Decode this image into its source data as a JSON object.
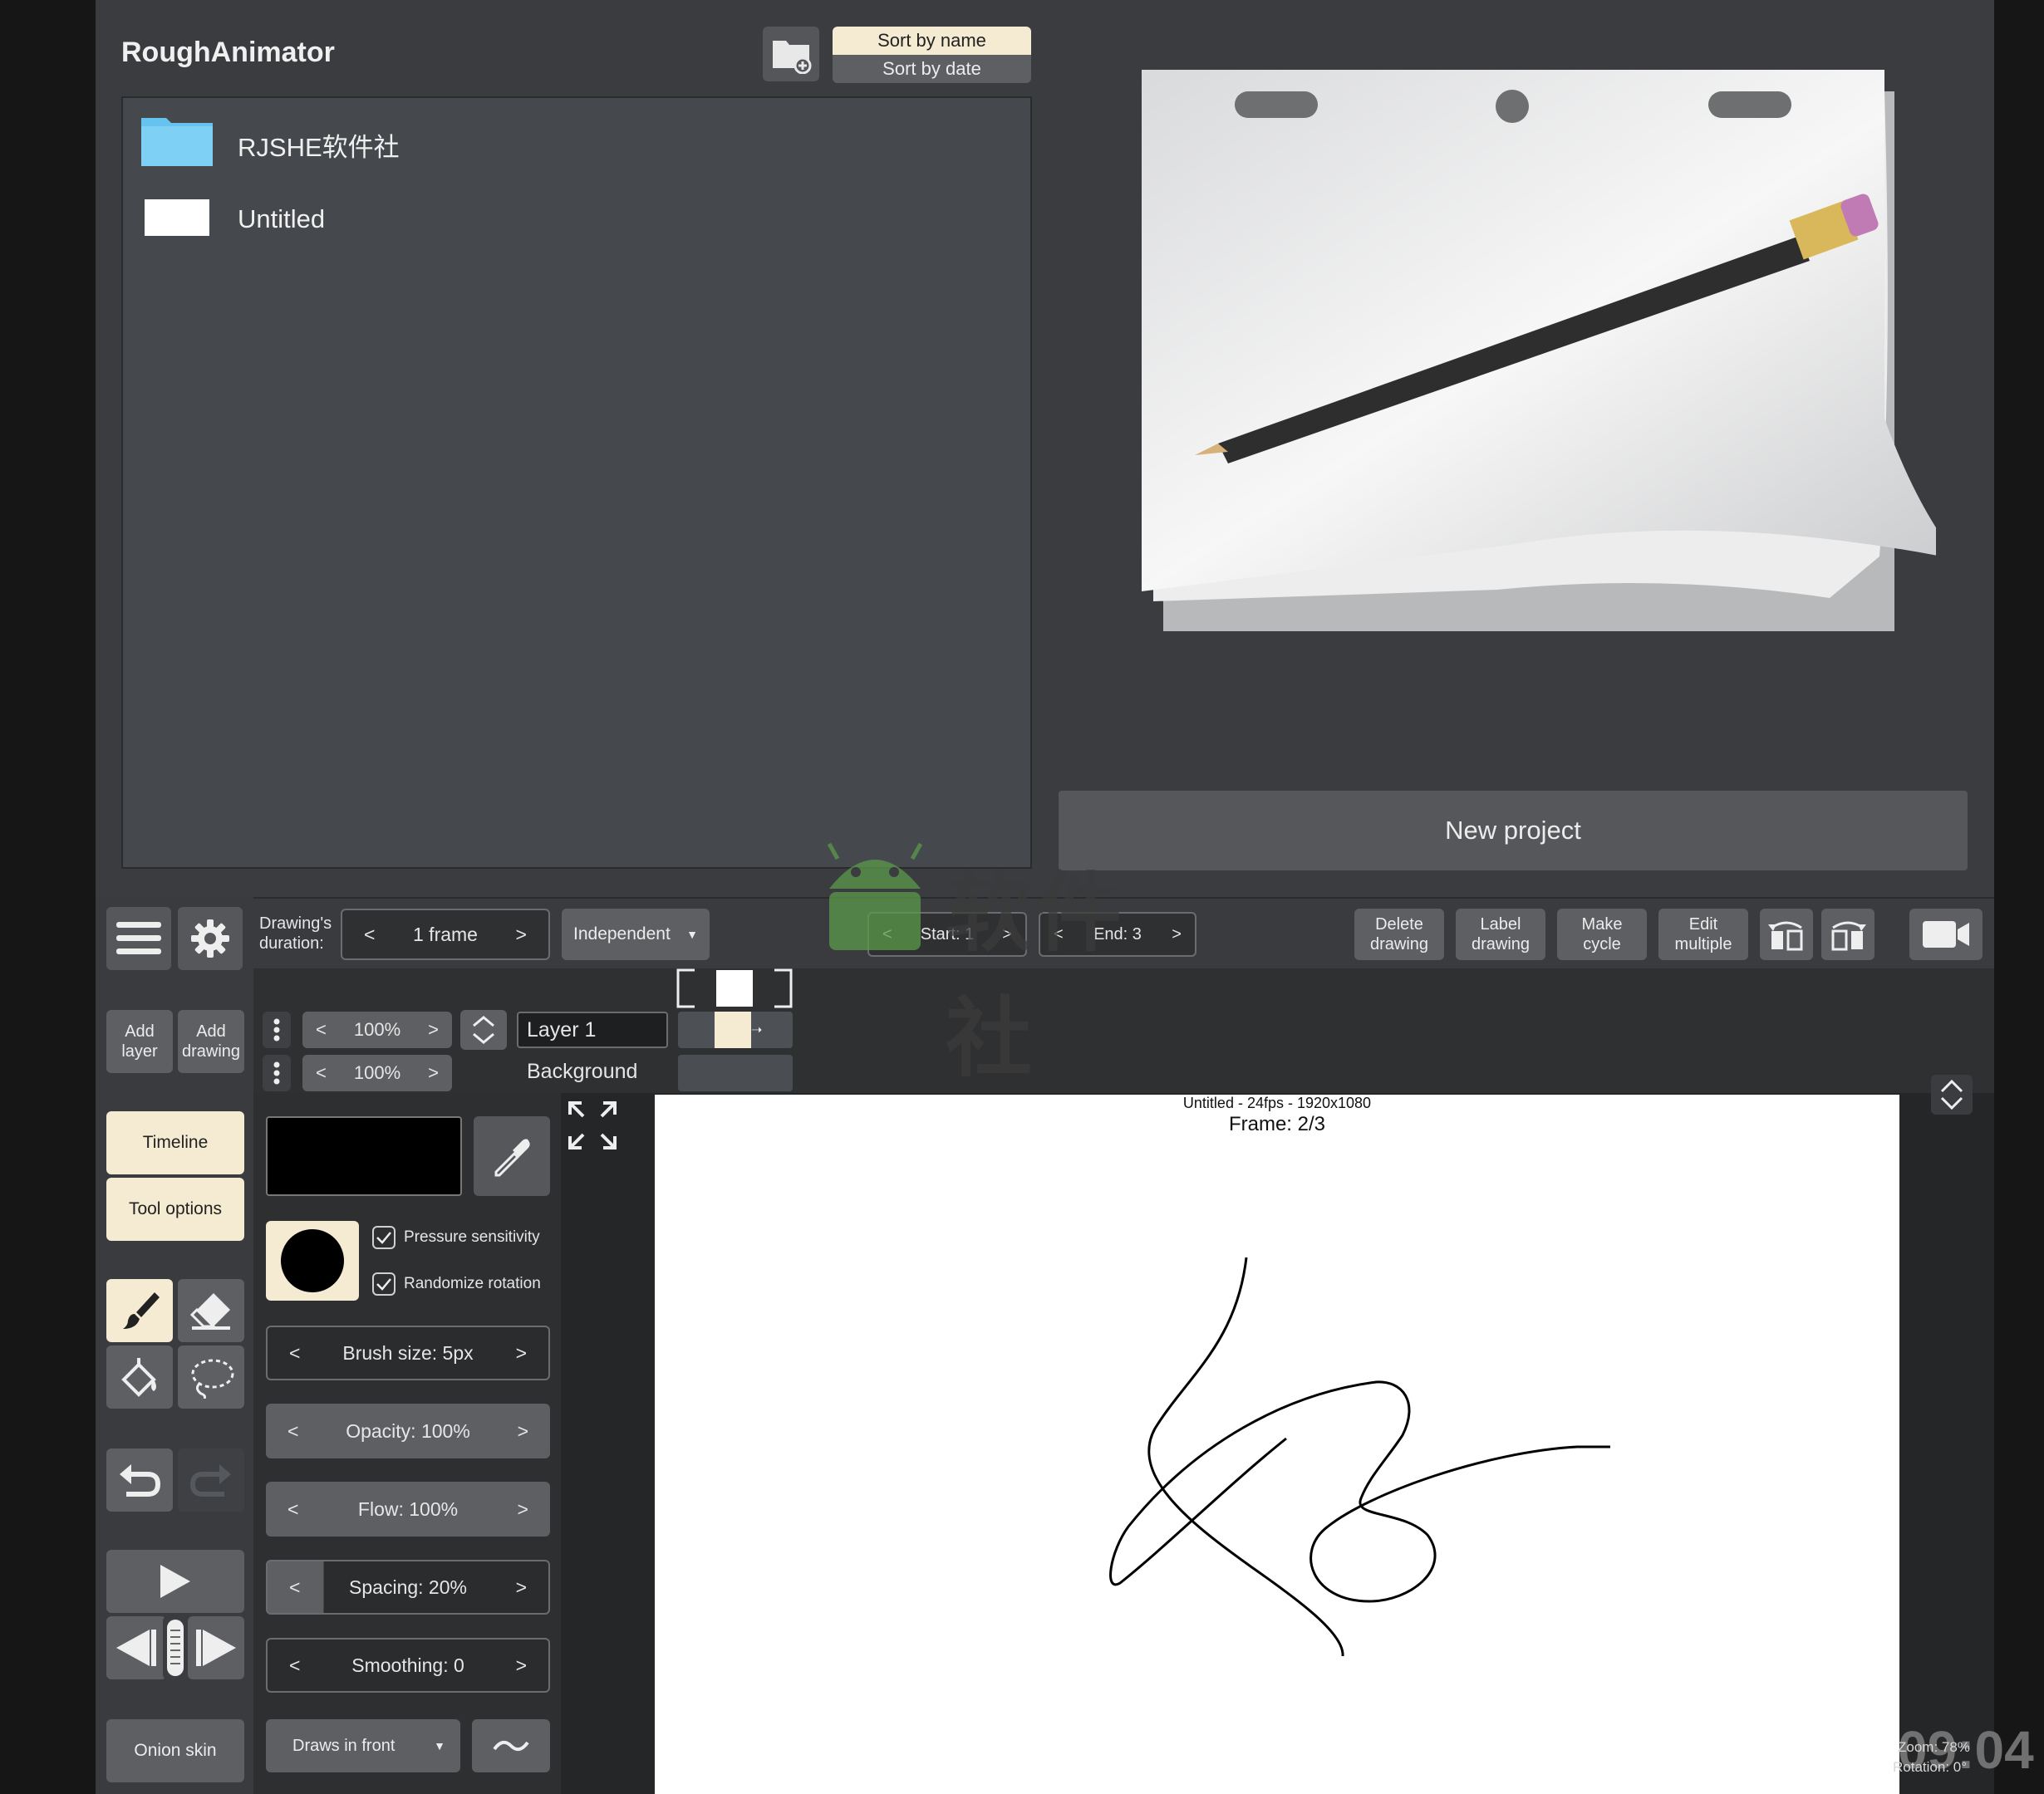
{
  "app": {
    "title": "RoughAnimator"
  },
  "browser": {
    "sort_options": [
      "Sort by name",
      "Sort by date"
    ],
    "items": [
      {
        "label": "RJSHE软件社",
        "kind": "folder"
      },
      {
        "label": "Untitled",
        "kind": "project"
      }
    ],
    "new_project_label": "New project"
  },
  "toolbar": {
    "duration_label": "Drawing's duration:",
    "duration_value": "1 frame",
    "mode_label": "Independent",
    "start_label": "Start: 1",
    "end_label": "End: 3",
    "delete_drawing": "Delete drawing",
    "label_drawing": "Label drawing",
    "make_cycle": "Make cycle",
    "edit_multiple": "Edit multiple"
  },
  "sidebar": {
    "add_layer": "Add layer",
    "add_drawing": "Add drawing",
    "timeline": "Timeline",
    "tool_options": "Tool options",
    "onion_skin": "Onion skin"
  },
  "layers": [
    {
      "name": "Layer 1",
      "opacity": "100%"
    },
    {
      "name": "Background",
      "opacity": "100%"
    }
  ],
  "tool_options": {
    "pressure_sensitivity": "Pressure sensitivity",
    "randomize_rotation": "Randomize rotation",
    "brush_size": "Brush size:  5px",
    "opacity": "Opacity:  100%",
    "flow": "Flow:  100%",
    "spacing": "Spacing:  20%",
    "smoothing": "Smoothing:  0",
    "draw_order": "Draws in front",
    "pressure_checked": true,
    "randomize_checked": true
  },
  "canvas": {
    "info": "Untitled - 24fps - 1920x1080",
    "frame": "Frame: 2/3",
    "zoom": "Zoom: 78%",
    "rotation": "Rotation: 0°"
  },
  "overlay": {
    "watermark": "软件社",
    "clock": "09:04"
  },
  "colors": {
    "accent_cream": "#f4ebd2",
    "panel": "#404347",
    "folder_blue": "#66c3f0",
    "brush_color": "#000000"
  },
  "icons": [
    "new-folder-icon",
    "menu-icon",
    "gear-icon",
    "camera-icon",
    "flip-left-icon",
    "flip-right-icon",
    "brush-icon",
    "eraser-icon",
    "fill-icon",
    "lasso-icon",
    "undo-icon",
    "redo-icon",
    "play-icon",
    "prev-frame-icon",
    "next-frame-icon",
    "eyedropper-icon",
    "fullscreen-icon",
    "collapse-icon",
    "stroke-icon"
  ]
}
